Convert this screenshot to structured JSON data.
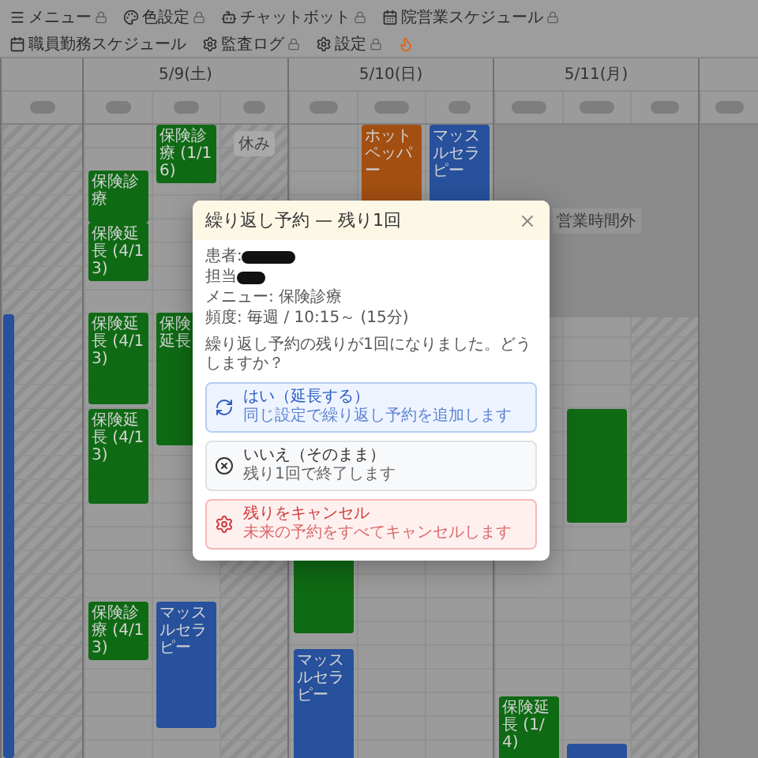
{
  "nav": {
    "items": [
      {
        "label": "メニュー",
        "locked": true
      },
      {
        "label": "色設定",
        "locked": true
      },
      {
        "label": "チャットボット",
        "locked": true
      },
      {
        "label": "院営業スケジュール",
        "locked": true
      },
      {
        "label": "職員勤務スケジュール",
        "locked": false
      },
      {
        "label": "監査ログ",
        "locked": true
      },
      {
        "label": "設定",
        "locked": true
      }
    ]
  },
  "calendar": {
    "leading_events": [
      {
        "color": "#27519c"
      }
    ],
    "days": [
      {
        "date": "5/9(土)",
        "columns": [
          {
            "closed": false,
            "events": [
              {
                "label": "保険診療",
                "color": "#0f6a14"
              },
              {
                "label": "保険延長 (4/13)",
                "color": "#0f6a14"
              },
              {
                "label": "保険延長 (4/13)",
                "color": "#0f6a14"
              },
              {
                "label": "保険延長 (4/13)",
                "color": "#0f6a14"
              },
              {
                "label": "保険診療 (4/13)",
                "color": "#0f6a14"
              }
            ]
          },
          {
            "closed": false,
            "events": [
              {
                "label": "保険診療 (1/16)",
                "color": "#0f6a14"
              },
              {
                "label": "保険延長",
                "color": "#0f6a14"
              },
              {
                "label": "マッスルセラピー",
                "color": "#27519c"
              }
            ]
          },
          {
            "closed": true,
            "note": "休み"
          }
        ]
      },
      {
        "date": "5/10(日)",
        "columns": [
          {
            "closed": false,
            "events": [
              {
                "color": "#0f6a14"
              },
              {
                "label": "マッスルセラピー",
                "color": "#27519c"
              }
            ]
          },
          {
            "closed": false,
            "events": [
              {
                "label": "ホットペッパー",
                "color": "#a34f12"
              }
            ]
          },
          {
            "closed": false,
            "events": [
              {
                "label": "マッスルセラピー",
                "color": "#27519c"
              }
            ]
          }
        ]
      },
      {
        "date": "5/11(月)",
        "off_hours": "営業時間外",
        "columns": [
          {
            "closed": false,
            "events": [
              {
                "label": "保険延長 (1/4)",
                "color": "#0f6a14"
              }
            ]
          },
          {
            "closed": false,
            "events": [
              {
                "color": "#0f6a14"
              },
              {
                "color": "#27519c"
              }
            ]
          },
          {
            "closed": true
          }
        ]
      }
    ]
  },
  "dialog": {
    "title": "繰り返し予約 — 残り1回",
    "fields": [
      {
        "label": "患者:"
      },
      {
        "label": "担当"
      }
    ],
    "menu": "メニュー: 保険診療",
    "frequency": "頻度: 毎週 / 10:15～ (15分)",
    "question": "繰り返し予約の残りが1回になりました。どうしますか？",
    "options": [
      {
        "kind": "extend",
        "title": "はい（延長する）",
        "subtitle": "同じ設定で繰り返し予約を追加します"
      },
      {
        "kind": "keep",
        "title": "いいえ（そのまま）",
        "subtitle": "残り1回で終了します"
      },
      {
        "kind": "cancel",
        "title": "残りをキャンセル",
        "subtitle": "未来の予約をすべてキャンセルします"
      }
    ]
  }
}
